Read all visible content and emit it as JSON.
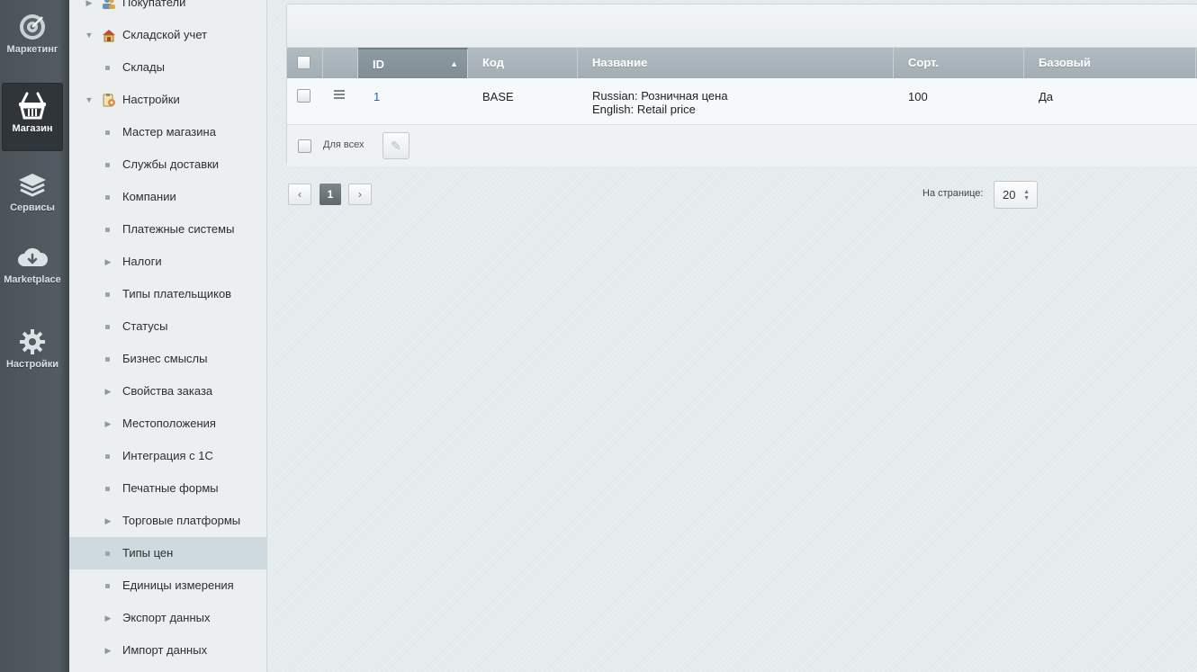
{
  "appbar": {
    "items": [
      {
        "label": "Маркетинг",
        "icon": "target-icon",
        "active": false
      },
      {
        "label": "Магазин",
        "icon": "basket-icon",
        "active": true
      },
      {
        "label": "Сервисы",
        "icon": "layers-icon",
        "active": false
      },
      {
        "label": "Marketplace",
        "icon": "cloud-download-icon",
        "active": false
      },
      {
        "label": "Настройки",
        "icon": "gear-icon",
        "active": false
      }
    ]
  },
  "tree": {
    "items": [
      {
        "label": "Покупатели",
        "level": 1,
        "kind": "arrow-right",
        "icon": "people-icon"
      },
      {
        "label": "Складской учет",
        "level": 1,
        "kind": "arrow-down",
        "icon": "warehouse-icon"
      },
      {
        "label": "Склады",
        "level": 2,
        "kind": "dot"
      },
      {
        "label": "Настройки",
        "level": 1,
        "kind": "arrow-down",
        "icon": "settings-clipboard-icon"
      },
      {
        "label": "Мастер магазина",
        "level": 2,
        "kind": "dot"
      },
      {
        "label": "Службы доставки",
        "level": 2,
        "kind": "dot"
      },
      {
        "label": "Компании",
        "level": 2,
        "kind": "dot"
      },
      {
        "label": "Платежные системы",
        "level": 2,
        "kind": "dot"
      },
      {
        "label": "Налоги",
        "level": 2,
        "kind": "arrow-right"
      },
      {
        "label": "Типы плательщиков",
        "level": 2,
        "kind": "dot"
      },
      {
        "label": "Статусы",
        "level": 2,
        "kind": "dot"
      },
      {
        "label": "Бизнес смыслы",
        "level": 2,
        "kind": "dot"
      },
      {
        "label": "Свойства заказа",
        "level": 2,
        "kind": "arrow-right"
      },
      {
        "label": "Местоположения",
        "level": 2,
        "kind": "arrow-right"
      },
      {
        "label": "Интеграция с 1С",
        "level": 2,
        "kind": "dot"
      },
      {
        "label": "Печатные формы",
        "level": 2,
        "kind": "dot"
      },
      {
        "label": "Торговые платформы",
        "level": 2,
        "kind": "arrow-right"
      },
      {
        "label": "Типы цен",
        "level": 2,
        "kind": "dot",
        "selected": true
      },
      {
        "label": "Единицы измерения",
        "level": 2,
        "kind": "dot"
      },
      {
        "label": "Экспорт данных",
        "level": 2,
        "kind": "arrow-right"
      },
      {
        "label": "Импорт данных",
        "level": 2,
        "kind": "arrow-right"
      }
    ]
  },
  "grid": {
    "columns": {
      "id": "ID",
      "code": "Код",
      "name": "Название",
      "sort": "Сорт.",
      "base": "Базовый"
    },
    "rows": [
      {
        "id": "1",
        "code": "BASE",
        "name_ru": "Russian: Розничная цена",
        "name_en": "English: Retail price",
        "sort": "100",
        "base": "Да"
      }
    ],
    "footer": {
      "for_all": "Для всех"
    }
  },
  "pagination": {
    "prev": "‹",
    "current": "1",
    "next": "›",
    "per_page_label": "На странице:",
    "per_page_value": "20"
  }
}
